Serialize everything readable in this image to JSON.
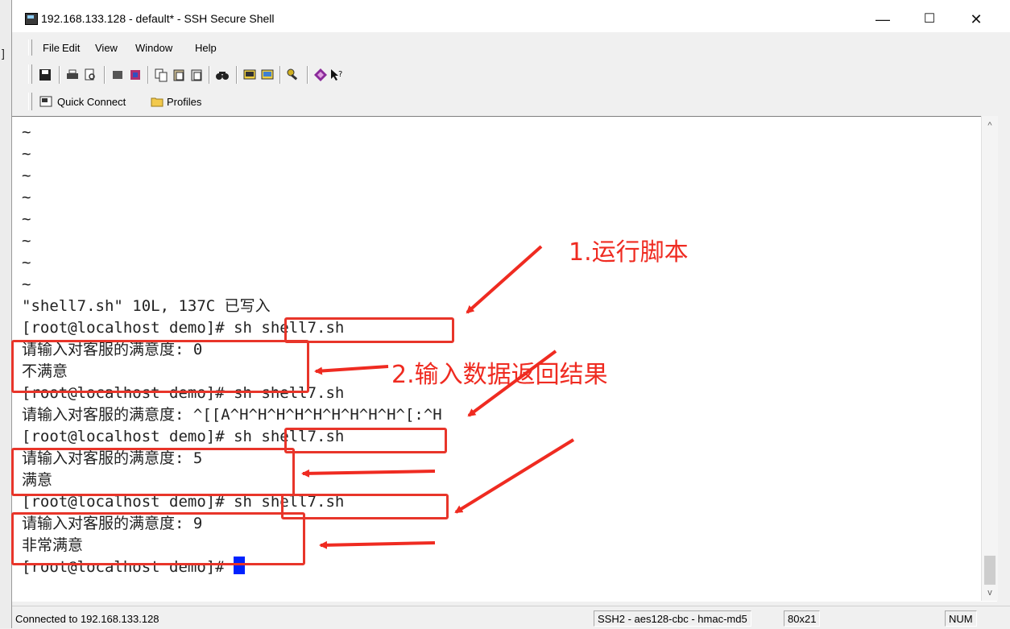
{
  "window": {
    "title": "192.168.133.128 - default* - SSH Secure Shell",
    "min": "—",
    "max": "☐",
    "close": "✕"
  },
  "menu": [
    "File",
    "Edit",
    "View",
    "Window",
    "Help"
  ],
  "toolbar": {
    "icons": [
      "save-icon",
      "print-icon",
      "print-preview-icon",
      "profile-icon",
      "settings-icon",
      "copy-icon",
      "paste-icon",
      "paste-alt-icon",
      "find-icon",
      "new-terminal-icon",
      "new-file-transfer-icon",
      "key-icon",
      "help-book-icon",
      "context-help-icon"
    ]
  },
  "quickbar": {
    "quick_connect": "Quick Connect",
    "profiles": "Profiles"
  },
  "terminal": {
    "lines": [
      "~",
      "~",
      "~",
      "~",
      "~",
      "~",
      "~",
      "~",
      "\"shell7.sh\" 10L, 137C 已写入",
      "[root@localhost demo]# sh shell7.sh",
      "请输入对客服的满意度: 0",
      "不满意",
      "[root@localhost demo]# sh shell7.sh",
      "请输入对客服的满意度: ^[[A^H^H^H^H^H^H^H^H^H^[:^H",
      "[root@localhost demo]# sh shell7.sh",
      "请输入对客服的满意度: 5",
      "满意",
      "[root@localhost demo]# sh shell7.sh",
      "请输入对客服的满意度: 9",
      "非常满意",
      "[root@localhost demo]# "
    ]
  },
  "annotations": {
    "step1": "1.运行脚本",
    "step2": "2.输入数据返回结果"
  },
  "status": {
    "connection": "Connected to 192.168.133.128",
    "cipher": "SSH2 - aes128-cbc - hmac-md5",
    "size": "80x21",
    "num": "NUM"
  },
  "colors": {
    "annotation": "#ef2b21",
    "cursor": "#0022ff"
  }
}
